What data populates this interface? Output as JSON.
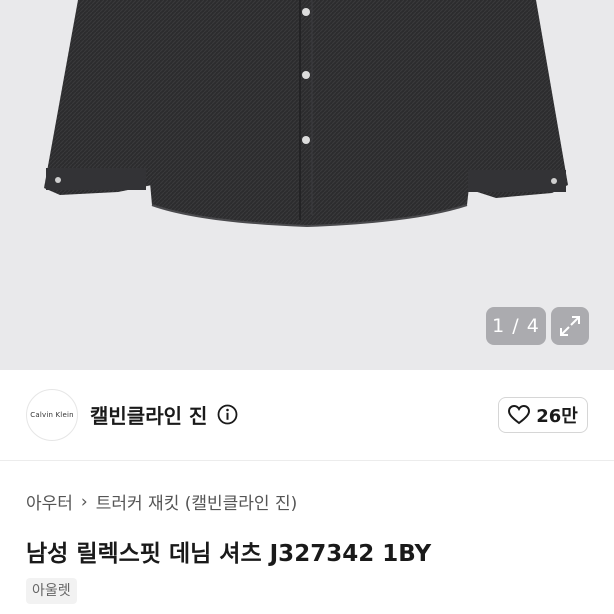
{
  "gallery": {
    "counter": "1 / 4"
  },
  "shop": {
    "logo_text": "Calvin Klein",
    "name": "캘빈클라인 진"
  },
  "like": {
    "count": "26만"
  },
  "breadcrumb": {
    "category": "아우터",
    "subcategory": "트러커 재킷 (캘빈클라인 진)"
  },
  "product": {
    "title": "남성 릴렉스핏 데님 셔츠 J327342 1BY",
    "tag": "아울렛"
  },
  "colors": {
    "hero_bg": "#e9e9eb",
    "shirt": "#2b2b2d",
    "text": "#1a1a1a"
  }
}
